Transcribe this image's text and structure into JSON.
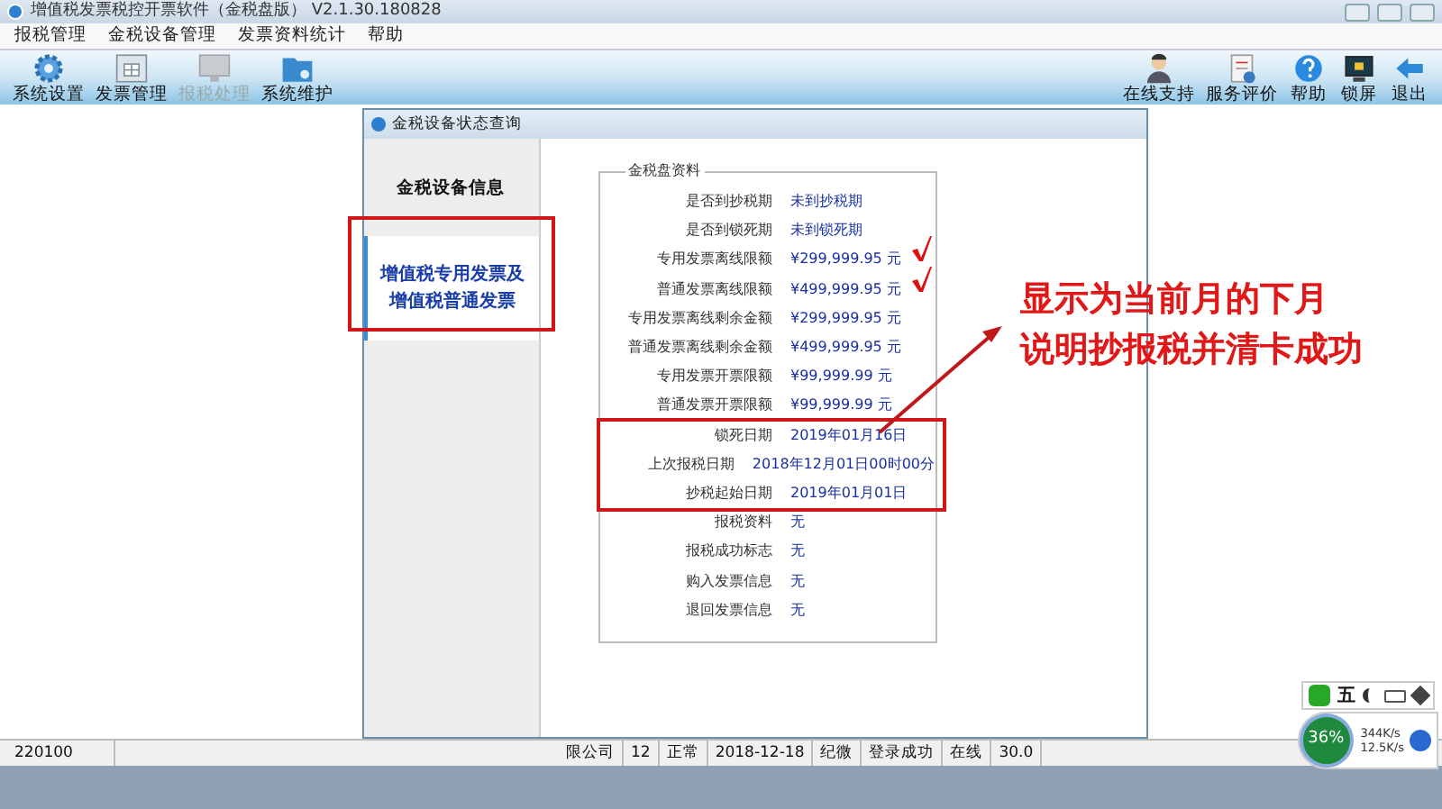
{
  "window": {
    "title": "增值税发票税控开票软件（金税盘版） V2.1.30.180828"
  },
  "menu": [
    "报税管理",
    "金税设备管理",
    "发票资料统计",
    "帮助"
  ],
  "toolbar_left": [
    {
      "label": "系统设置",
      "disabled": false,
      "kind": "gear"
    },
    {
      "label": "发票管理",
      "disabled": false,
      "kind": "grid"
    },
    {
      "label": "报税处理",
      "disabled": true,
      "kind": "monitor"
    },
    {
      "label": "系统维护",
      "disabled": false,
      "kind": "folder"
    }
  ],
  "toolbar_right": [
    {
      "label": "在线支持",
      "kind": "person"
    },
    {
      "label": "服务评价",
      "kind": "notebook"
    },
    {
      "label": "帮助",
      "kind": "help"
    },
    {
      "label": "锁屏",
      "kind": "screen"
    },
    {
      "label": "退出",
      "kind": "arrow"
    }
  ],
  "dialog": {
    "title": "金税设备状态查询",
    "tabs": [
      {
        "label": "金税设备信息",
        "selected": false
      },
      {
        "label": "增值税专用发票及增值税普通发票",
        "selected": true
      }
    ],
    "group_title": "金税盘资料",
    "rows": [
      {
        "label": "是否到抄税期",
        "value": "未到抄税期",
        "checked": false
      },
      {
        "label": "是否到锁死期",
        "value": "未到锁死期",
        "checked": false
      },
      {
        "label": "专用发票离线限额",
        "value": "¥299,999.95 元",
        "checked": true
      },
      {
        "label": "普通发票离线限额",
        "value": "¥499,999.95 元",
        "checked": true
      },
      {
        "label": "专用发票离线剩余金额",
        "value": "¥299,999.95 元",
        "checked": false
      },
      {
        "label": "普通发票离线剩余金额",
        "value": "¥499,999.95 元",
        "checked": false
      },
      {
        "label": "专用发票开票限额",
        "value": "¥99,999.99 元",
        "checked": false
      },
      {
        "label": "普通发票开票限额",
        "value": "¥99,999.99 元",
        "checked": false
      },
      {
        "label": "锁死日期",
        "value": "2019年01月16日",
        "checked": false
      },
      {
        "label": "上次报税日期",
        "value": "2018年12月01日00时00分",
        "checked": false
      },
      {
        "label": "抄税起始日期",
        "value": "2019年01月01日",
        "checked": false
      },
      {
        "label": "报税资料",
        "value": "无",
        "checked": false
      },
      {
        "label": "报税成功标志",
        "value": "无",
        "checked": false
      },
      {
        "label": "购入发票信息",
        "value": "无",
        "checked": false
      },
      {
        "label": "退回发票信息",
        "value": "无",
        "checked": false
      }
    ]
  },
  "annotation": [
    "显示为当前月的下月",
    "说明抄报税并清卡成功"
  ],
  "ime_bar": {
    "label": "五"
  },
  "status_bar": [
    "220100",
    "限公司",
    "12",
    "正常",
    "2018-12-18",
    "纪微",
    "登录成功",
    "在线",
    "30.0"
  ],
  "net_widget": {
    "percent": "36%",
    "up": "344K/s",
    "down": "12.5K/s"
  }
}
